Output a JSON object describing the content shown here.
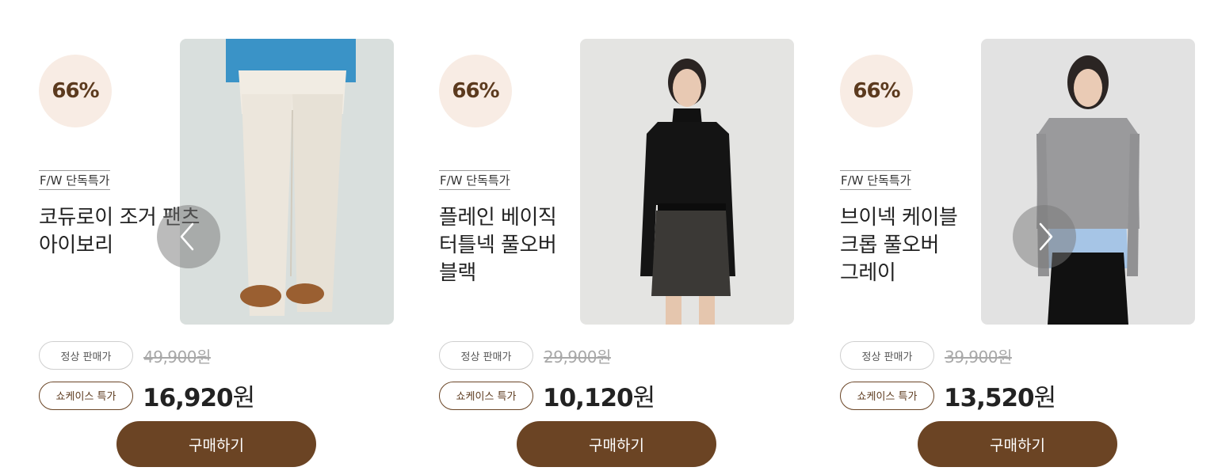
{
  "carousel": {
    "prev_icon": "chevron-left-icon",
    "next_icon": "chevron-right-icon"
  },
  "colors": {
    "accent_brown": "#6b4424",
    "badge_bg": "#f8ece4",
    "badge_text": "#5c3a1e"
  },
  "products": [
    {
      "discount": "66%",
      "promo_tag": "F/W 단독특가",
      "title_lines": [
        "코듀로이 조거 팬츠",
        "아이보리"
      ],
      "regular_label": "정상 판매가",
      "original_price": "49,900원",
      "sale_label": "쇼케이스 특가",
      "sale_amount": "16,920",
      "sale_unit": "원",
      "buy_label": "구매하기"
    },
    {
      "discount": "66%",
      "promo_tag": "F/W 단독특가",
      "title_lines": [
        "플레인 베이직",
        "터틀넥 풀오버",
        "블랙"
      ],
      "regular_label": "정상 판매가",
      "original_price": "29,900원",
      "sale_label": "쇼케이스 특가",
      "sale_amount": "10,120",
      "sale_unit": "원",
      "buy_label": "구매하기"
    },
    {
      "discount": "66%",
      "promo_tag": "F/W 단독특가",
      "title_lines": [
        "브이넥 케이블",
        "크롭 풀오버",
        "그레이"
      ],
      "regular_label": "정상 판매가",
      "original_price": "39,900원",
      "sale_label": "쇼케이스 특가",
      "sale_amount": "13,520",
      "sale_unit": "원",
      "buy_label": "구매하기"
    }
  ]
}
